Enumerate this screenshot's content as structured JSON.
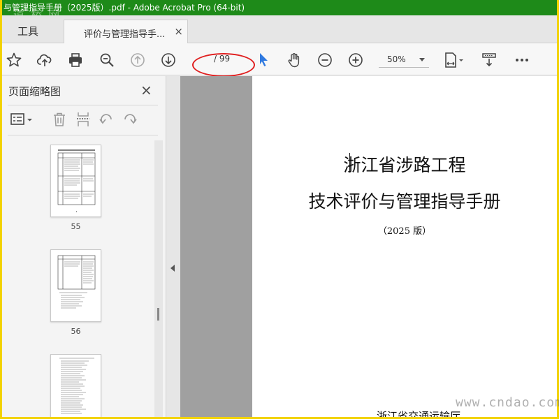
{
  "window": {
    "title": "与管理指导手册（2025版）.pdf - Adobe Acrobat Pro (64-bit)",
    "watermark_top": "道 桥 网"
  },
  "tabs": {
    "tools": "工具",
    "document": "评价与管理指导手...",
    "close": "×"
  },
  "toolbar": {
    "icons": [
      "star-icon",
      "upload-icon",
      "print-icon",
      "zoom-search-icon",
      "page-up-icon",
      "page-down-icon",
      "select-arrow-icon",
      "hand-icon",
      "zoom-out-icon",
      "zoom-in-icon",
      "page-fit-icon",
      "scroll-mode-icon",
      "more-icon"
    ],
    "page_current": "",
    "page_total": "/ 99",
    "zoom": "50%",
    "annotation_color": "#e02020"
  },
  "sidepanel": {
    "title": "页面缩略图",
    "close": "×",
    "thumbnails": [
      {
        "page": "55"
      },
      {
        "page": "56"
      },
      {
        "page": ""
      }
    ]
  },
  "document": {
    "title_line1": "浙江省涉路工程",
    "title_line2": "技术评价与管理指导手册",
    "edition": "（2025 版）",
    "cut_line": "浙江省交通运输厅"
  },
  "watermark_bottom": "www.cndao.com",
  "colors": {
    "title_bar": "#1e8a19",
    "frame": "#f2d200",
    "doc_gray": "#a0a0a0",
    "select_blue": "#2f79e0"
  }
}
